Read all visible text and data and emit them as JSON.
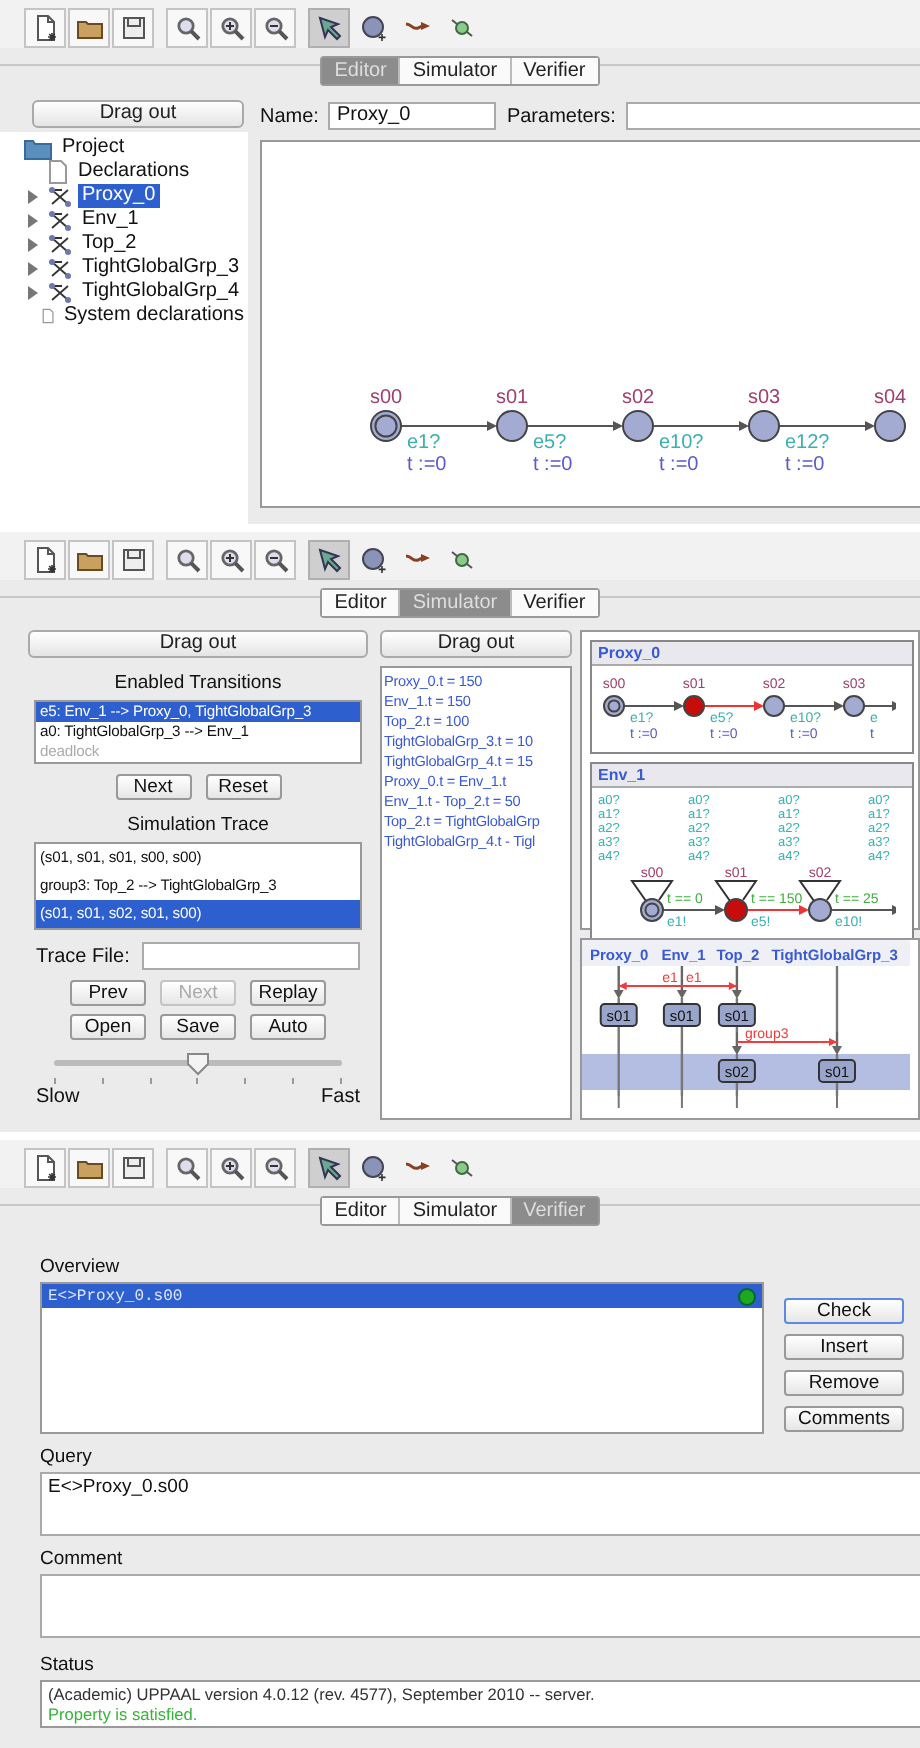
{
  "panels": [
    {
      "kind": "editor",
      "tabs": [
        {
          "label": "Editor",
          "selected": true
        },
        {
          "label": "Simulator",
          "selected": false
        },
        {
          "label": "Verifier",
          "selected": false
        }
      ],
      "edit_tools": [
        {
          "selected": true
        },
        {
          "selected": false
        },
        {
          "selected": false
        },
        {
          "selected": false
        }
      ],
      "drag_out": "Drag out",
      "tree": [
        {
          "label": "Project",
          "kind": "folder",
          "selected": false,
          "children": [
            {
              "label": "Declarations",
              "kind": "document",
              "selected": false
            },
            {
              "label": "Proxy_0",
              "kind": "template",
              "selected": true,
              "expanded": false
            },
            {
              "label": "Env_1",
              "kind": "template",
              "selected": false,
              "expanded": false
            },
            {
              "label": "Top_2",
              "kind": "template",
              "selected": false,
              "expanded": false
            },
            {
              "label": "TightGlobalGrp_3",
              "kind": "template",
              "selected": false,
              "expanded": false
            },
            {
              "label": "TightGlobalGrp_4",
              "kind": "template",
              "selected": false,
              "expanded": false
            },
            {
              "label": "System declarations",
              "kind": "document",
              "selected": false
            }
          ]
        }
      ],
      "name_label": "Name:",
      "name_value": "Proxy_0",
      "parameters_label": "Parameters:",
      "automaton": {
        "states": [
          {
            "name": "s00",
            "initial": true,
            "active": false
          },
          {
            "name": "s01",
            "initial": false,
            "active": false
          },
          {
            "name": "s02",
            "initial": false,
            "active": false
          },
          {
            "name": "s03",
            "initial": false,
            "active": false
          },
          {
            "name": "s04",
            "initial": false,
            "active": false
          }
        ],
        "edges": [
          {
            "sync": "e1?",
            "update": "t :=0",
            "highlighted": false
          },
          {
            "sync": "e5?",
            "update": "t :=0",
            "highlighted": false
          },
          {
            "sync": "e10?",
            "update": "t :=0",
            "highlighted": false
          },
          {
            "sync": "e12?",
            "update": "t :=0",
            "highlighted": false
          }
        ]
      }
    },
    {
      "kind": "simulator",
      "tabs": [
        {
          "label": "Editor",
          "selected": false
        },
        {
          "label": "Simulator",
          "selected": true
        },
        {
          "label": "Verifier",
          "selected": false
        }
      ],
      "edit_tools": [
        {
          "selected": true
        },
        {
          "selected": false
        },
        {
          "selected": false
        },
        {
          "selected": false
        }
      ],
      "drag_out": "Drag out",
      "enabled_transitions": {
        "title": "Enabled Transitions",
        "items": [
          {
            "text": "e5: Env_1 --> Proxy_0, TightGlobalGrp_3",
            "selected": true,
            "disabled": false
          },
          {
            "text": "a0: TightGlobalGrp_3 --> Env_1",
            "selected": false,
            "disabled": false
          },
          {
            "text": "deadlock",
            "selected": false,
            "disabled": true
          }
        ]
      },
      "transition_buttons": [
        {
          "label": "Next",
          "disabled": false
        },
        {
          "label": "Reset",
          "disabled": false
        }
      ],
      "trace": {
        "title": "Simulation Trace",
        "items": [
          {
            "text": "(s01, s01, s01, s00, s00)",
            "selected": false
          },
          {
            "text": "group3: Top_2 --> TightGlobalGrp_3",
            "selected": false
          },
          {
            "text": "(s01, s01, s02, s01, s00)",
            "selected": true
          }
        ]
      },
      "trace_file_label": "Trace File:",
      "trace_buttons": [
        {
          "label": "Prev",
          "disabled": false
        },
        {
          "label": "Next",
          "disabled": true
        },
        {
          "label": "Replay",
          "disabled": false
        },
        {
          "label": "Open",
          "disabled": false
        },
        {
          "label": "Save",
          "disabled": false
        },
        {
          "label": "Auto",
          "disabled": false
        }
      ],
      "speed": {
        "level": 0.5,
        "min_label": "Slow",
        "max_label": "Fast"
      },
      "variables_drag_out": "Drag out",
      "variables": [
        "Proxy_0.t = 150",
        "Env_1.t = 150",
        "Top_2.t = 100",
        "TightGlobalGrp_3.t = 10",
        "TightGlobalGrp_4.t = 15",
        "Proxy_0.t = Env_1.t",
        "Env_1.t - Top_2.t = 50",
        "Top_2.t = TightGlobalGrp",
        "TightGlobalGrp_4.t - Tigl"
      ],
      "processes": [
        {
          "title": "Proxy_0",
          "kind": "chain",
          "automaton": {
            "states": [
              {
                "name": "s00",
                "initial": true,
                "active": false
              },
              {
                "name": "s01",
                "initial": false,
                "active": true
              },
              {
                "name": "s02",
                "initial": false,
                "active": false
              },
              {
                "name": "s03",
                "initial": false,
                "active": false
              }
            ],
            "edges": [
              {
                "sync": "e1?",
                "update": "t :=0",
                "highlighted": false
              },
              {
                "sync": "e5?",
                "update": "t :=0",
                "highlighted": true
              },
              {
                "sync": "e10?",
                "update": "t :=0",
                "highlighted": false
              },
              {
                "sync": "e",
                "update": "t",
                "highlighted": false
              }
            ]
          }
        },
        {
          "title": "Env_1",
          "kind": "looped",
          "loop_label_columns": [
            [
              "a0?",
              "a1?",
              "a2?",
              "a3?",
              "a4?"
            ],
            [
              "a0?",
              "a1?",
              "a2?",
              "a3?",
              "a4?"
            ],
            [
              "a0?",
              "a1?",
              "a2?",
              "a3?",
              "a4?"
            ],
            [
              "a0?",
              "a1?",
              "a2?",
              "a3?",
              "a4?"
            ]
          ],
          "automaton": {
            "states": [
              {
                "name": "s00",
                "initial": true,
                "active": false
              },
              {
                "name": "s01",
                "initial": false,
                "active": true
              },
              {
                "name": "s02",
                "initial": false,
                "active": false
              }
            ],
            "edges": [
              {
                "guard": "t == 0",
                "sync": "e1!",
                "highlighted": false
              },
              {
                "guard": "t == 150",
                "sync": "e5!",
                "highlighted": true
              },
              {
                "guard": "t == 25",
                "sync": "e10!",
                "highlighted": false
              }
            ]
          }
        }
      ],
      "sequence_chart": {
        "processes": [
          "Proxy_0",
          "Env_1",
          "Top_2",
          "TightGlobalGrp_3"
        ],
        "steps": [
          {
            "kind": "broadcast",
            "labels": [
              "e1",
              "e1"
            ],
            "lanes": [
              true,
              true,
              true,
              false
            ]
          },
          {
            "kind": "states",
            "selected": false,
            "lanes": [
              true,
              true,
              true,
              false
            ],
            "states": [
              "s01",
              "s01",
              "s01"
            ]
          },
          {
            "kind": "sync",
            "labels": [
              "group3"
            ],
            "lanes": [
              false,
              false,
              true,
              true
            ]
          },
          {
            "kind": "states",
            "selected": true,
            "lanes": [
              false,
              false,
              true,
              true
            ],
            "states": [
              "s02",
              "s01"
            ]
          }
        ]
      }
    },
    {
      "kind": "verifier",
      "tabs": [
        {
          "label": "Editor",
          "selected": false
        },
        {
          "label": "Simulator",
          "selected": false
        },
        {
          "label": "Verifier",
          "selected": true
        }
      ],
      "edit_tools": [
        {
          "selected": true
        },
        {
          "selected": false
        },
        {
          "selected": false
        },
        {
          "selected": false
        }
      ],
      "overview_label": "Overview",
      "queries": [
        {
          "text": "E<>Proxy_0.s00",
          "selected": true,
          "color": "#1fa81f"
        }
      ],
      "buttons": [
        {
          "label": "Check",
          "default": true
        },
        {
          "label": "Insert",
          "default": false
        },
        {
          "label": "Remove",
          "default": false
        },
        {
          "label": "Comments",
          "default": false
        }
      ],
      "query_label": "Query",
      "query_value": "E<>Proxy_0.s00",
      "comment_label": "Comment",
      "status_label": "Status",
      "status_lines": [
        {
          "text": "(Academic) UPPAAL version 4.0.12 (rev. 4577), September 2010 -- server.",
          "kind": "info"
        },
        {
          "text": "Property is satisfied.",
          "kind": "success"
        }
      ]
    }
  ]
}
